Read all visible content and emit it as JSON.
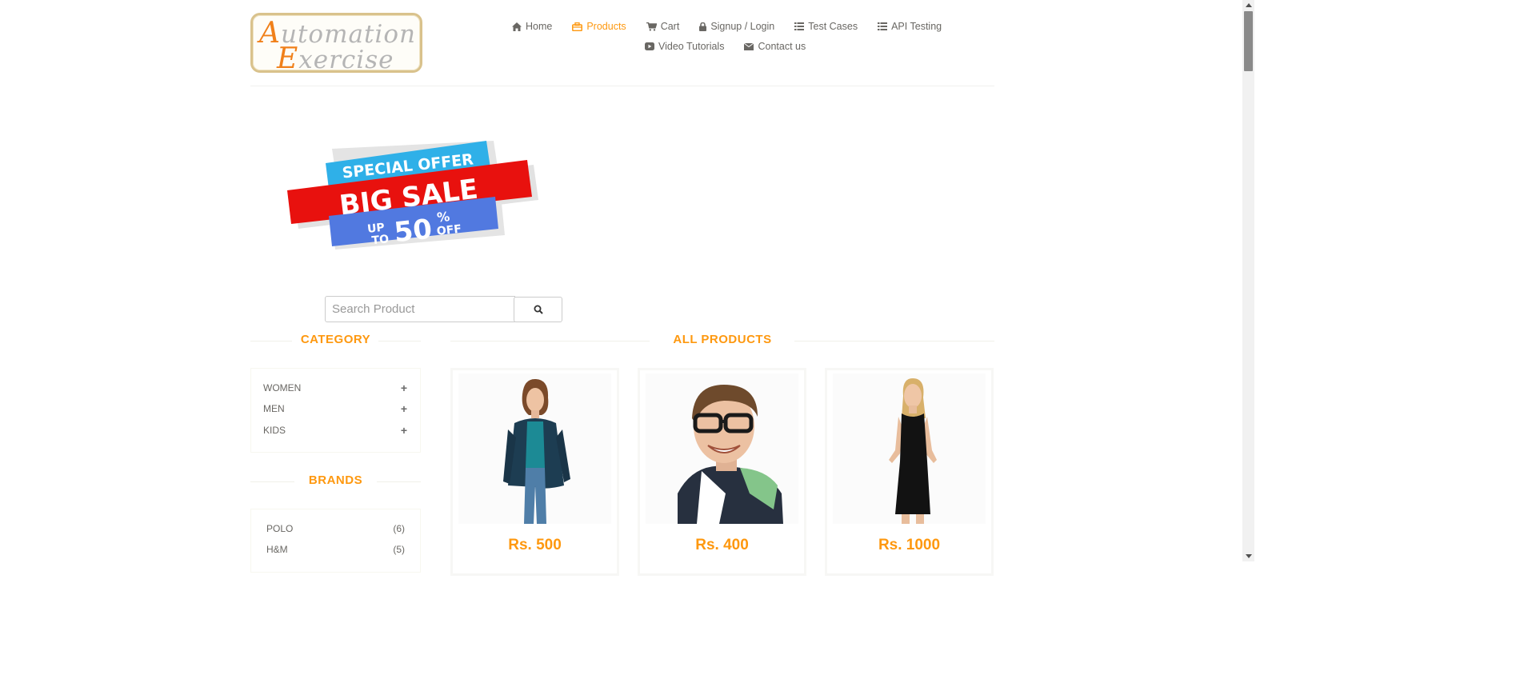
{
  "logo": {
    "line1_cap": "A",
    "line1_rest": "utomation",
    "line2_cap": "E",
    "line2_rest": "xercise"
  },
  "nav": {
    "items": [
      {
        "label": "Home",
        "icon": "home-icon"
      },
      {
        "label": "Products",
        "icon": "products-icon",
        "active": true
      },
      {
        "label": "Cart",
        "icon": "cart-icon"
      },
      {
        "label": "Signup / Login",
        "icon": "lock-icon"
      },
      {
        "label": "Test Cases",
        "icon": "list-icon"
      },
      {
        "label": "API Testing",
        "icon": "list-icon"
      },
      {
        "label": "Video Tutorials",
        "icon": "youtube-play-icon"
      },
      {
        "label": "Contact us",
        "icon": "envelope-icon"
      }
    ]
  },
  "banner": {
    "line1": "SPECIAL OFFER",
    "line2": "BIG SALE",
    "up": "UP",
    "to": "TO",
    "number": "50",
    "percent": "%",
    "off": "OFF"
  },
  "search": {
    "placeholder": "Search Product",
    "value": ""
  },
  "sidebar": {
    "category_title": "CATEGORY",
    "categories": [
      {
        "label": "WOMEN"
      },
      {
        "label": "MEN"
      },
      {
        "label": "KIDS"
      }
    ],
    "brands_title": "BRANDS",
    "brands": [
      {
        "label": "POLO",
        "count": "(6)"
      },
      {
        "label": "H&M",
        "count": "(5)"
      }
    ]
  },
  "main": {
    "title": "ALL PRODUCTS",
    "products": [
      {
        "price": "Rs. 500"
      },
      {
        "price": "Rs. 400"
      },
      {
        "price": "Rs. 1000"
      }
    ]
  },
  "colors": {
    "accent": "#fe980f",
    "text": "#696763",
    "border": "#f7f7f0"
  }
}
